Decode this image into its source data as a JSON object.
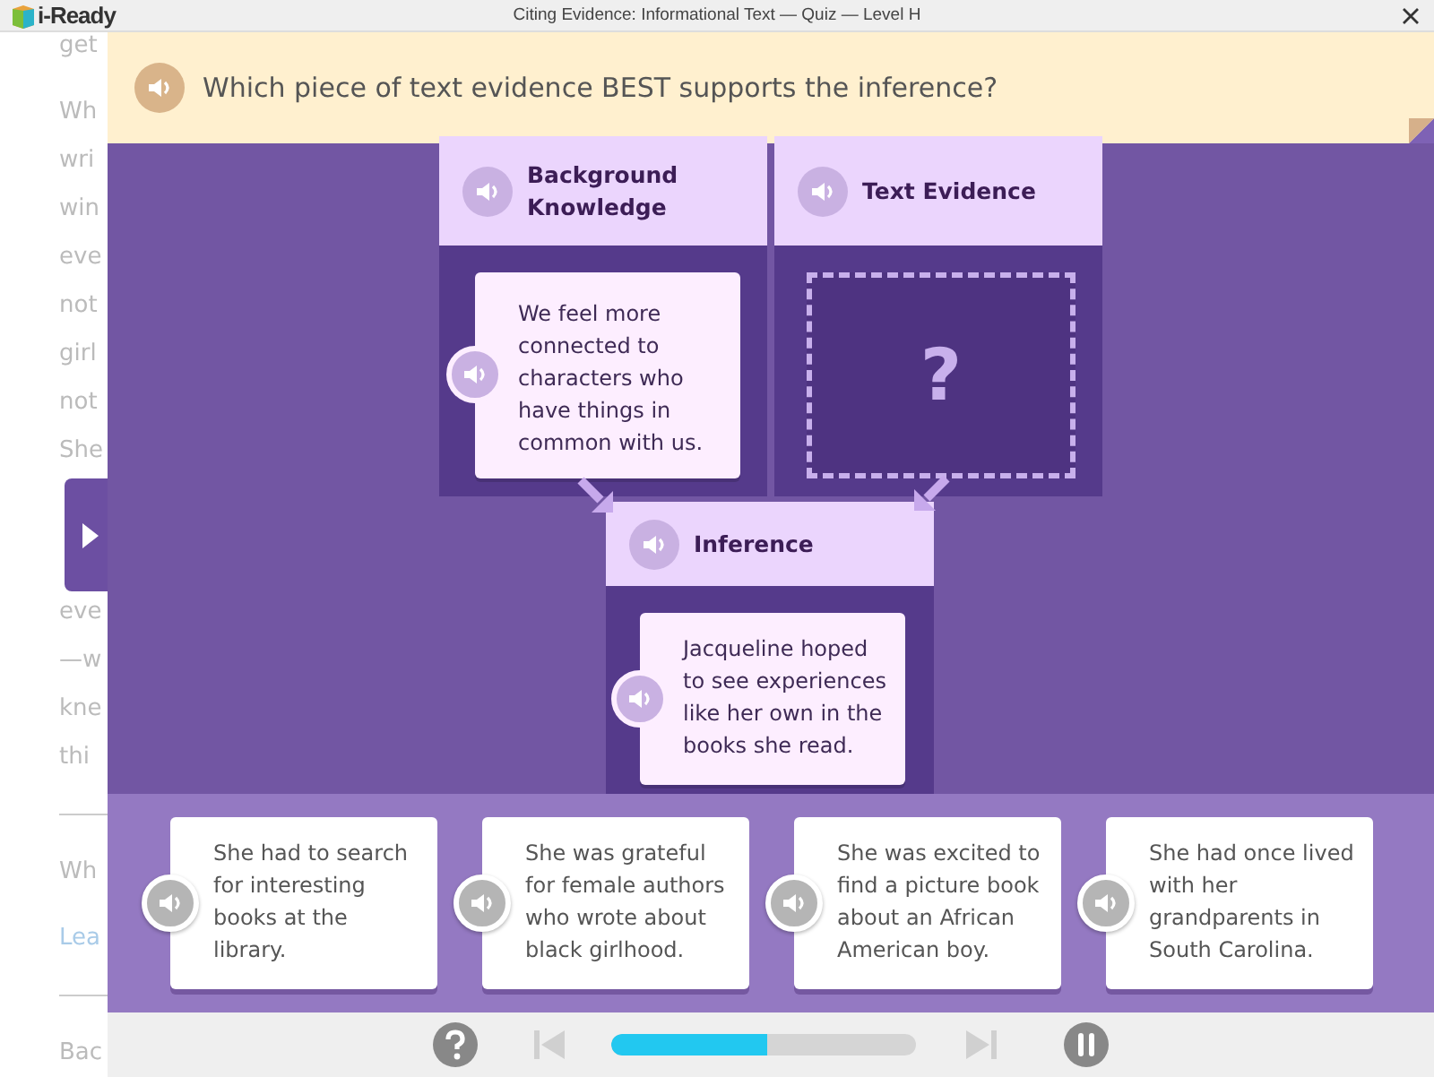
{
  "window": {
    "logo": "i-Ready",
    "title": "Citing Evidence: Informational Text — Quiz — Level H"
  },
  "background_blocks": [
    {
      "kind": "paragraph",
      "lines": [
        "get"
      ]
    },
    {
      "kind": "paragraph",
      "lines": [
        "Wh",
        "wri",
        "win",
        "eve",
        "not",
        "girl",
        "not",
        "She"
      ]
    },
    {
      "kind": "tab"
    },
    {
      "kind": "paragraph",
      "lines": [
        "eve",
        "—w",
        "kne",
        "thi"
      ]
    },
    {
      "kind": "divider"
    },
    {
      "kind": "paragraph",
      "lines": [
        "Wh"
      ]
    },
    {
      "kind": "link",
      "lines": [
        "Lea"
      ]
    },
    {
      "kind": "divider"
    },
    {
      "kind": "paragraph",
      "lines": [
        "Bac"
      ]
    }
  ],
  "question": "Which piece of text evidence BEST supports the inference?",
  "diagram": [
    {
      "kind": "given",
      "title": "Background Knowledge",
      "text": "We feel more connected to characters who have things in common with us."
    },
    {
      "kind": "blank",
      "title": "Text Evidence",
      "text": "?"
    },
    {
      "kind": "given",
      "title": "Inference",
      "text": "Jacqueline hoped to see experiences like her own in the books she read."
    }
  ],
  "answers": [
    {
      "text": "She had to search for interesting books at the library."
    },
    {
      "text": "She was grateful for female authors who wrote about black girlhood."
    },
    {
      "text": "She was excited to find a picture book about an African American boy."
    },
    {
      "text": "She had once lived with her grandparents in South Carolina."
    }
  ],
  "controls": {
    "progress": {
      "level": 0.51
    },
    "previous_disabled": true,
    "next_disabled": true
  }
}
